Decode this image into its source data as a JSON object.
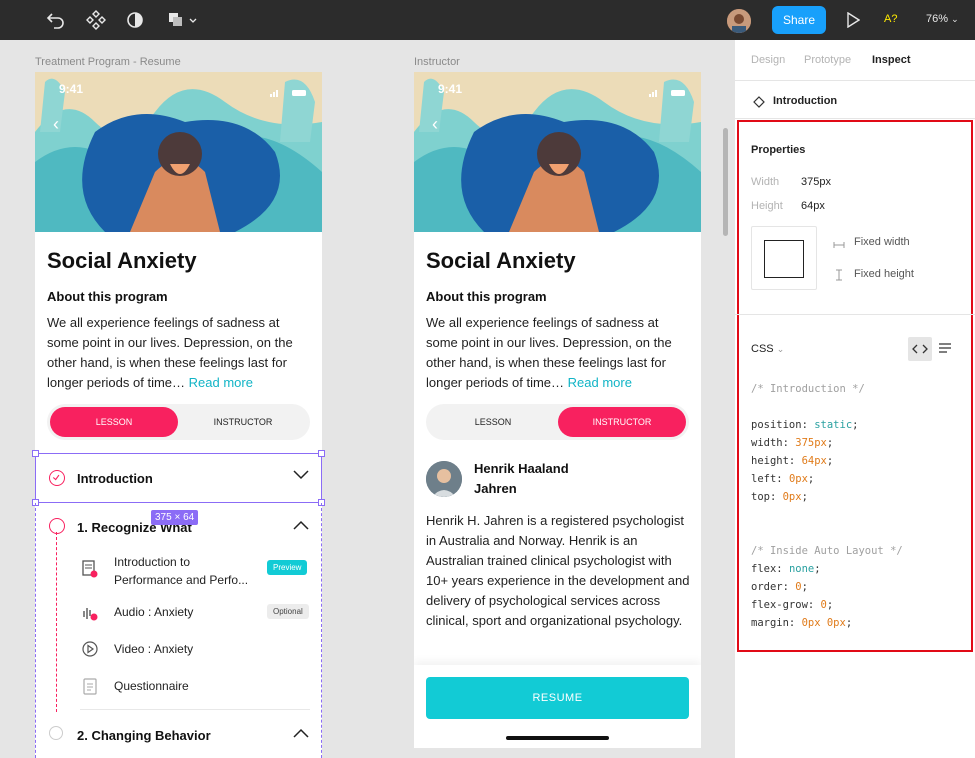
{
  "toolbar": {
    "share_label": "Share",
    "a_label": "A?",
    "zoom_label": "76%"
  },
  "frames": [
    {
      "label": "Treatment Program - Resume",
      "time": "9:41",
      "title": "Social Anxiety",
      "subtitle": "About this program",
      "body": "We all experience feelings of sadness at some point in our lives. Depression, on the other hand, is when these feelings last for longer periods of time…",
      "read_more": "Read more",
      "toggle": [
        "LESSON",
        "INSTRUCTOR"
      ],
      "selected_section": "Introduction",
      "size_badge": "375 × 64",
      "section1": "1. Recognize What",
      "lessons": [
        {
          "title": "Introduction to Performance and Perfo...",
          "badge": "Preview"
        },
        {
          "title": "Audio : Anxiety",
          "badge": "Optional"
        },
        {
          "title": "Video : Anxiety",
          "badge": ""
        },
        {
          "title": "Questionnaire",
          "badge": ""
        }
      ],
      "section2": "2. Changing Behavior"
    },
    {
      "label": "Instructor",
      "time": "9:41",
      "title": "Social Anxiety",
      "subtitle": "About this program",
      "body": "We all experience feelings of sadness at some point in our lives. Depression, on the other hand, is when these feelings last for longer periods of time…",
      "read_more": "Read more",
      "toggle": [
        "LESSON",
        "INSTRUCTOR"
      ],
      "instructor_name": "Henrik Haaland Jahren",
      "instructor_bio": "Henrik H. Jahren is a registered psychologist in Australia and Norway. Henrik is an Australian trained clinical psychologist with 10+ years experience in the development and delivery of psychological services across clinical, sport and organizational psychology.",
      "resume_label": "RESUME"
    }
  ],
  "inspect": {
    "tabs": [
      "Design",
      "Prototype",
      "Inspect"
    ],
    "active_tab": "Inspect",
    "selection": "Introduction",
    "properties_heading": "Properties",
    "width_label": "Width",
    "width_value": "375px",
    "height_label": "Height",
    "height_value": "64px",
    "fixed_width": "Fixed width",
    "fixed_height": "Fixed height",
    "css_label": "CSS",
    "css_comment1": "/* Introduction */",
    "css_lines1": [
      [
        "position",
        "static"
      ],
      [
        "width",
        "375px"
      ],
      [
        "height",
        "64px"
      ],
      [
        "left",
        "0px"
      ],
      [
        "top",
        "0px"
      ]
    ],
    "css_comment2": "/* Inside Auto Layout */",
    "css_lines2": [
      [
        "flex",
        "none"
      ],
      [
        "order",
        "0"
      ],
      [
        "flex-grow",
        "0"
      ],
      [
        "margin",
        "0px 0px"
      ]
    ]
  },
  "colors": {
    "accent_pink": "#f8215f",
    "accent_teal": "#12cbd5",
    "figma_blue": "#18a0fb",
    "selection_purple": "#8b6cf6",
    "highlight_red": "#e10a17"
  }
}
